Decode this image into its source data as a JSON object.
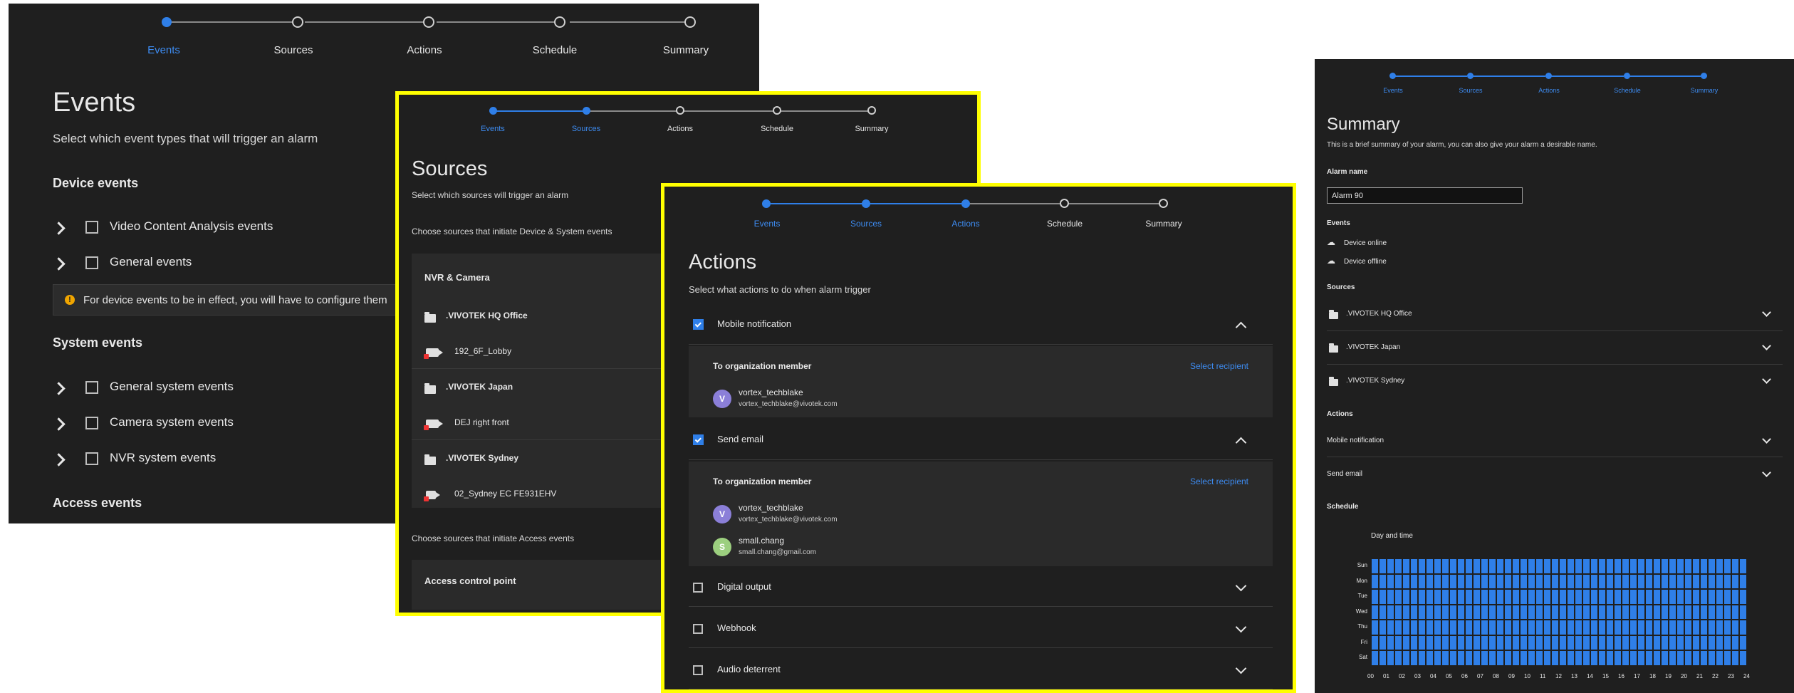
{
  "steps": [
    "Events",
    "Sources",
    "Actions",
    "Schedule",
    "Summary"
  ],
  "events_panel": {
    "title": "Events",
    "subtitle": "Select which event types that will trigger an alarm",
    "device_heading": "Device events",
    "device_items": [
      "Video Content Analysis events",
      "General events"
    ],
    "info_text": "For device events to be in effect, you will have to configure them",
    "system_heading": "System events",
    "system_items": [
      "General system events",
      "Camera system events",
      "NVR system events"
    ],
    "access_heading": "Access events"
  },
  "sources_panel": {
    "title": "Sources",
    "subtitle": "Select which sources will trigger an alarm",
    "device_prompt": "Choose sources that initiate Device & System events",
    "group_title": "NVR & Camera",
    "sites": [
      {
        "name": ".VIVOTEK HQ Office",
        "camera": "192_6F_Lobby"
      },
      {
        "name": ".VIVOTEK Japan",
        "camera": "DEJ right front"
      },
      {
        "name": ".VIVOTEK Sydney",
        "camera": "02_Sydney EC FE931EHV"
      }
    ],
    "access_prompt": "Choose sources that initiate Access events",
    "access_group": "Access control point"
  },
  "actions_panel": {
    "title": "Actions",
    "subtitle": "Select what actions to do when alarm trigger",
    "mobile_label": "Mobile notification",
    "email_label": "Send email",
    "org_member": "To organization member",
    "select_recipient": "Select recipient",
    "mobile_recipients": [
      {
        "initial": "V",
        "name": "vortex_techblake",
        "email": "vortex_techblake@vivotek.com"
      }
    ],
    "email_recipients": [
      {
        "initial": "V",
        "name": "vortex_techblake",
        "email": "vortex_techblake@vivotek.com"
      },
      {
        "initial": "S",
        "name": "small.chang",
        "email": "small.chang@gmail.com"
      }
    ],
    "other_actions": [
      "Digital output",
      "Webhook",
      "Audio deterrent"
    ]
  },
  "summary_panel": {
    "title": "Summary",
    "subtitle": "This is a brief summary of your alarm, you can also give your alarm a desirable name.",
    "alarm_name_label": "Alarm name",
    "alarm_name_value": "Alarm 90",
    "events_heading": "Events",
    "events": [
      "Device online",
      "Device offline"
    ],
    "sources_heading": "Sources",
    "sources": [
      ".VIVOTEK HQ Office",
      ".VIVOTEK Japan",
      ".VIVOTEK Sydney"
    ],
    "actions_heading": "Actions",
    "actions": [
      "Mobile notification",
      "Send email"
    ],
    "schedule_heading": "Schedule",
    "day_time_label": "Day and time",
    "days": [
      "Sun",
      "Mon",
      "Tue",
      "Wed",
      "Thu",
      "Fri",
      "Sat"
    ],
    "hours": [
      "00",
      "01",
      "02",
      "03",
      "04",
      "05",
      "06",
      "07",
      "08",
      "09",
      "10",
      "11",
      "12",
      "13",
      "14",
      "15",
      "16",
      "17",
      "18",
      "19",
      "20",
      "21",
      "22",
      "23",
      "24"
    ]
  },
  "colors": {
    "accent": "#2f7fe8",
    "highlight_border": "#ffff00",
    "panel_bg": "#1f1f1f"
  }
}
